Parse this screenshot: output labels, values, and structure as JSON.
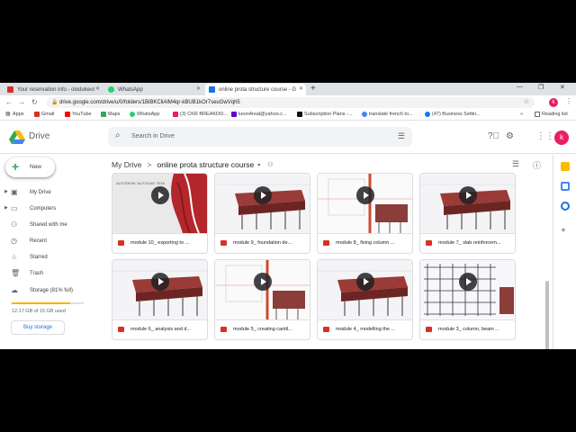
{
  "browser": {
    "tabs": [
      {
        "title": "Your reservation info - olodukeol",
        "favicon_color": "#d93025"
      },
      {
        "title": "WhatsApp",
        "favicon_color": "#25d366"
      },
      {
        "title": "online prota structure course - G",
        "favicon_color": "#1a73e8"
      }
    ],
    "new_tab": "+",
    "url": "drive.google.com/drive/u/0/folders/1BiBKCliAlM4qr-kBUB1kOr7seuGwVqh5",
    "profile_letter": "k",
    "reading_list": "Reading list",
    "bookmarks": [
      {
        "label": "Apps",
        "color": "#5f6368"
      },
      {
        "label": "Gmail",
        "color": "#d93025"
      },
      {
        "label": "YouTube",
        "color": "#ff0000"
      },
      {
        "label": "Maps",
        "color": "#34a853"
      },
      {
        "label": "WhatsApp",
        "color": "#25d366"
      },
      {
        "label": "(3) CKR BREAKDO...",
        "color": "#e91e63"
      },
      {
        "label": "keon4real@yahoo.c...",
        "color": "#6001d2"
      },
      {
        "label": "Subscription Plans -...",
        "color": "#111111"
      },
      {
        "label": "translate french to...",
        "color": "#4285f4"
      },
      {
        "label": "(47) Business Settin...",
        "color": "#1877f2"
      }
    ]
  },
  "drive": {
    "title": "Drive",
    "search_placeholder": "Search in Drive",
    "avatar_letter": "k",
    "new_label": "New",
    "nav": [
      {
        "label": "My Drive",
        "icon": "drive-icon"
      },
      {
        "label": "Computers",
        "icon": "computer-icon"
      },
      {
        "label": "Shared with me",
        "icon": "people-icon"
      },
      {
        "label": "Recent",
        "icon": "clock-icon"
      },
      {
        "label": "Starred",
        "icon": "star-icon"
      },
      {
        "label": "Trash",
        "icon": "trash-icon"
      }
    ],
    "storage": {
      "label": "Storage (81% full)",
      "fraction": 0.81,
      "used": "12.17 GB of 15 GB used",
      "buy": "Buy storage"
    },
    "breadcrumb": {
      "root": "My Drive",
      "separator": ">",
      "current": "online prota structure course"
    },
    "files": [
      {
        "name": "module 10_ exporting to ...",
        "thumb": "autocad"
      },
      {
        "name": "module 9_ foundation de...",
        "thumb": "frame"
      },
      {
        "name": "module 8_ fixing column ...",
        "thumb": "cad"
      },
      {
        "name": "module 7_ slab reinforcem...",
        "thumb": "frame"
      },
      {
        "name": "module 6_ analysis and d...",
        "thumb": "frame"
      },
      {
        "name": "module 5_ creating cantil...",
        "thumb": "cad"
      },
      {
        "name": "module 4_ modelling the ...",
        "thumb": "frame"
      },
      {
        "name": "module 3_ column, beam ...",
        "thumb": "grid"
      }
    ],
    "thumb_text": {
      "autocad": "AUTODESK' AUTOCAD' 2016",
      "prota": "ProtaStructure"
    },
    "colors": {
      "accent": "#1a73e8",
      "storage_fill": "#f4b400",
      "video_icon": "#d93025"
    }
  }
}
